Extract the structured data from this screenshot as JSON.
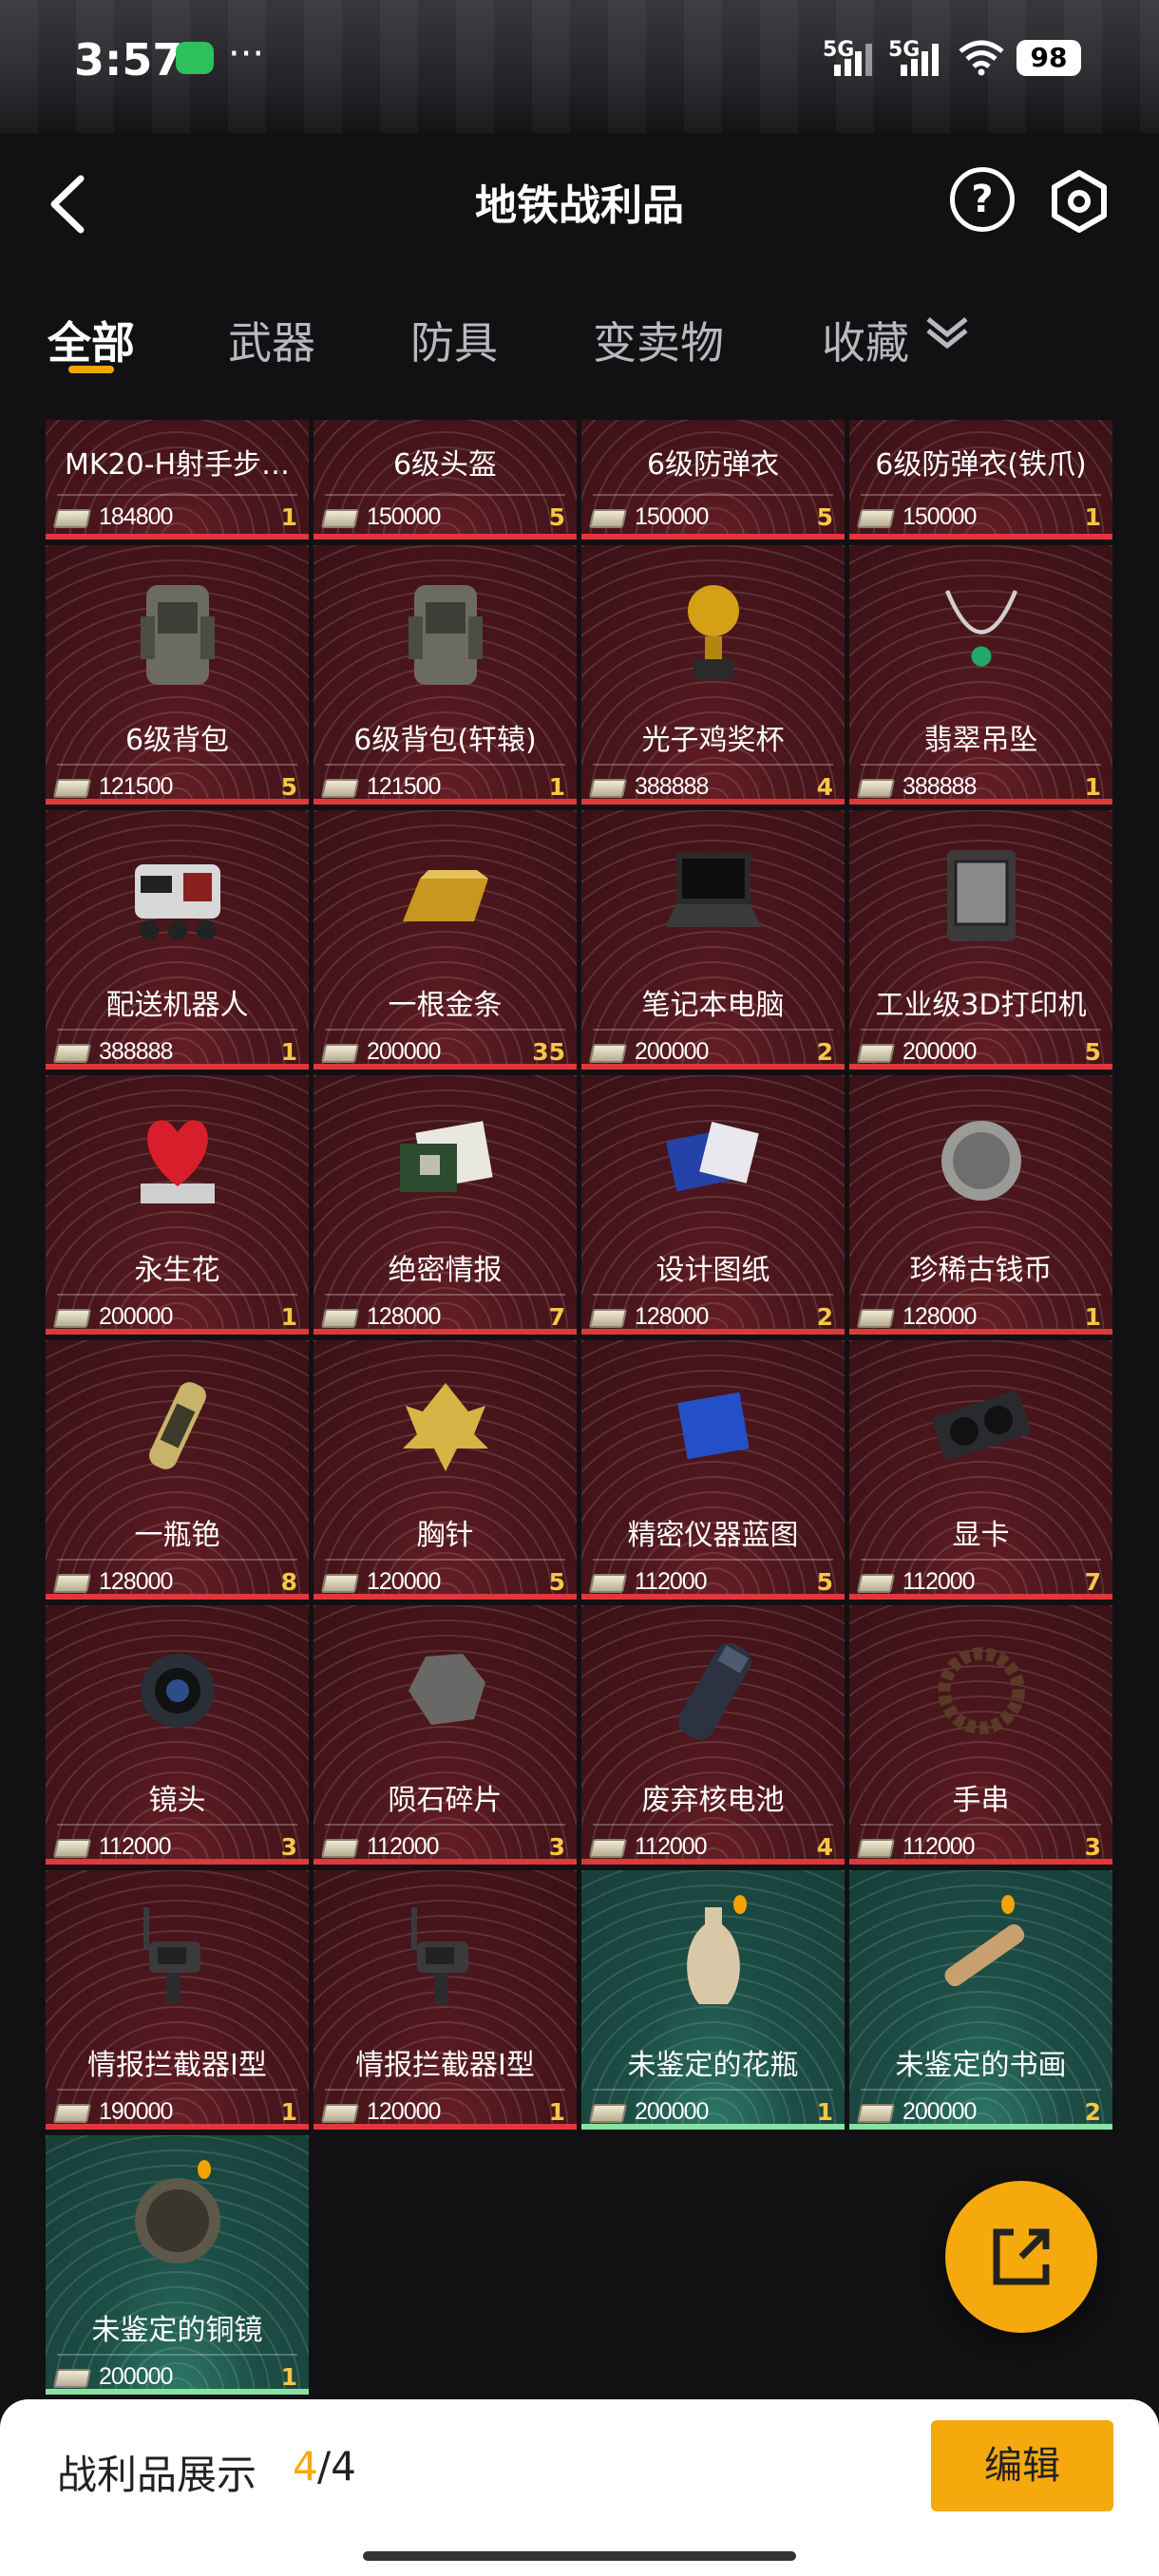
{
  "status": {
    "time": "3:57",
    "network1": "5G",
    "network2": "5G",
    "battery": "98"
  },
  "nav": {
    "title": "地铁战利品",
    "help_symbol": "?"
  },
  "tabs": [
    {
      "label": "全部",
      "active": true
    },
    {
      "label": "武器",
      "active": false
    },
    {
      "label": "防具",
      "active": false
    },
    {
      "label": "变卖物",
      "active": false
    },
    {
      "label": "收藏",
      "active": false
    }
  ],
  "items": [
    {
      "name": "MK20-H射手步…",
      "price": "184800",
      "count": "1",
      "icon": "rifle",
      "rarity": "red"
    },
    {
      "name": "6级头盔",
      "price": "150000",
      "count": "5",
      "icon": "helmet",
      "rarity": "red"
    },
    {
      "name": "6级防弹衣",
      "price": "150000",
      "count": "5",
      "icon": "vest",
      "rarity": "red"
    },
    {
      "name": "6级防弹衣(铁爪)",
      "price": "150000",
      "count": "1",
      "icon": "vest",
      "rarity": "red"
    },
    {
      "name": "6级背包",
      "price": "121500",
      "count": "5",
      "icon": "backpack",
      "rarity": "red"
    },
    {
      "name": "6级背包(轩辕)",
      "price": "121500",
      "count": "1",
      "icon": "backpack",
      "rarity": "red"
    },
    {
      "name": "光子鸡奖杯",
      "price": "388888",
      "count": "4",
      "icon": "trophy",
      "rarity": "red"
    },
    {
      "name": "翡翠吊坠",
      "price": "388888",
      "count": "1",
      "icon": "necklace",
      "rarity": "red"
    },
    {
      "name": "配送机器人",
      "price": "388888",
      "count": "1",
      "icon": "robot",
      "rarity": "red"
    },
    {
      "name": "一根金条",
      "price": "200000",
      "count": "35",
      "icon": "gold-bar",
      "rarity": "red"
    },
    {
      "name": "笔记本电脑",
      "price": "200000",
      "count": "2",
      "icon": "laptop",
      "rarity": "red"
    },
    {
      "name": "工业级3D打印机",
      "price": "200000",
      "count": "5",
      "icon": "printer",
      "rarity": "red"
    },
    {
      "name": "永生花",
      "price": "200000",
      "count": "1",
      "icon": "heart-flower",
      "rarity": "red"
    },
    {
      "name": "绝密情报",
      "price": "128000",
      "count": "7",
      "icon": "documents",
      "rarity": "red"
    },
    {
      "name": "设计图纸",
      "price": "128000",
      "count": "2",
      "icon": "blueprint",
      "rarity": "red"
    },
    {
      "name": "珍稀古钱币",
      "price": "128000",
      "count": "1",
      "icon": "coin",
      "rarity": "red"
    },
    {
      "name": "一瓶铯",
      "price": "128000",
      "count": "8",
      "icon": "vial",
      "rarity": "red"
    },
    {
      "name": "胸针",
      "price": "120000",
      "count": "5",
      "icon": "leaf-brooch",
      "rarity": "red"
    },
    {
      "name": "精密仪器蓝图",
      "price": "112000",
      "count": "5",
      "icon": "blue-sheet",
      "rarity": "red"
    },
    {
      "name": "显卡",
      "price": "112000",
      "count": "7",
      "icon": "gpu",
      "rarity": "red"
    },
    {
      "name": "镜头",
      "price": "112000",
      "count": "3",
      "icon": "lens",
      "rarity": "red"
    },
    {
      "name": "陨石碎片",
      "price": "112000",
      "count": "3",
      "icon": "meteorite",
      "rarity": "red"
    },
    {
      "name": "废弃核电池",
      "price": "112000",
      "count": "4",
      "icon": "battery-cell",
      "rarity": "red"
    },
    {
      "name": "手串",
      "price": "112000",
      "count": "3",
      "icon": "bracelet",
      "rarity": "red"
    },
    {
      "name": "情报拦截器I型",
      "price": "190000",
      "count": "1",
      "icon": "interceptor",
      "rarity": "red"
    },
    {
      "name": "情报拦截器I型",
      "price": "120000",
      "count": "1",
      "icon": "interceptor",
      "rarity": "red"
    },
    {
      "name": "未鉴定的花瓶",
      "price": "200000",
      "count": "1",
      "icon": "vase",
      "rarity": "green",
      "badge": true
    },
    {
      "name": "未鉴定的书画",
      "price": "200000",
      "count": "2",
      "icon": "scroll",
      "rarity": "green",
      "badge": true
    },
    {
      "name": "未鉴定的铜镜",
      "price": "200000",
      "count": "1",
      "icon": "bronze-mirror",
      "rarity": "green",
      "badge": true
    }
  ],
  "colors": {
    "accent": "#f5a90d",
    "red_card": "#4a161c",
    "green_card": "#1d4e45",
    "count": "#f6c646"
  },
  "bottom": {
    "label": "战利品展示",
    "count": "4",
    "total": "/4",
    "edit_label": "编辑"
  }
}
